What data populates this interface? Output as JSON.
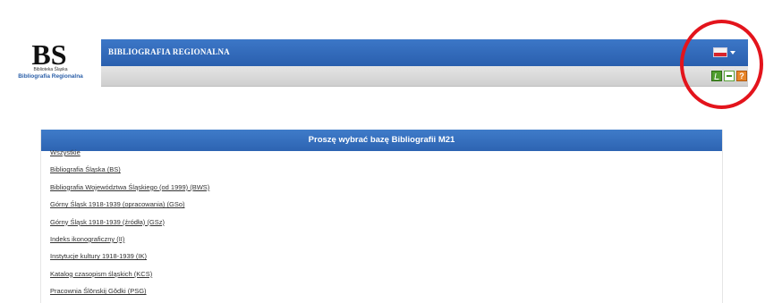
{
  "logo": {
    "mark": "BS",
    "line1": "Biblioteka Śląska",
    "line2": "Bibliografia Regionalna"
  },
  "header": {
    "title": "BIBLIOGRAFIA REGIONALNA",
    "language_icon": "flag-icon",
    "colors": {
      "bar": "#2f66b5",
      "annotation": "#e3141c"
    }
  },
  "toolbar": {
    "icons": [
      "edit-icon",
      "export-icon",
      "help-icon"
    ],
    "help_glyph": "?"
  },
  "panel": {
    "title": "Proszę wybrać bazę Bibliografii M21",
    "items": [
      "Wszystkie",
      "Bibliografia Śląska (BS)",
      "Bibliografia Województwa Śląskiego (od 1999) (BWS)",
      "Górny Śląsk 1918-1939 (opracowania) (GSo)",
      "Górny Śląsk 1918-1939 (źródła) (GSz)",
      "Indeks ikonograficzny (II)",
      "Instytucje kultury 1918-1939 (IK)",
      "Katalog czasopism śląskich (KCS)",
      "Pracownia Ślōnskij Gŏdki (PSG)"
    ]
  }
}
